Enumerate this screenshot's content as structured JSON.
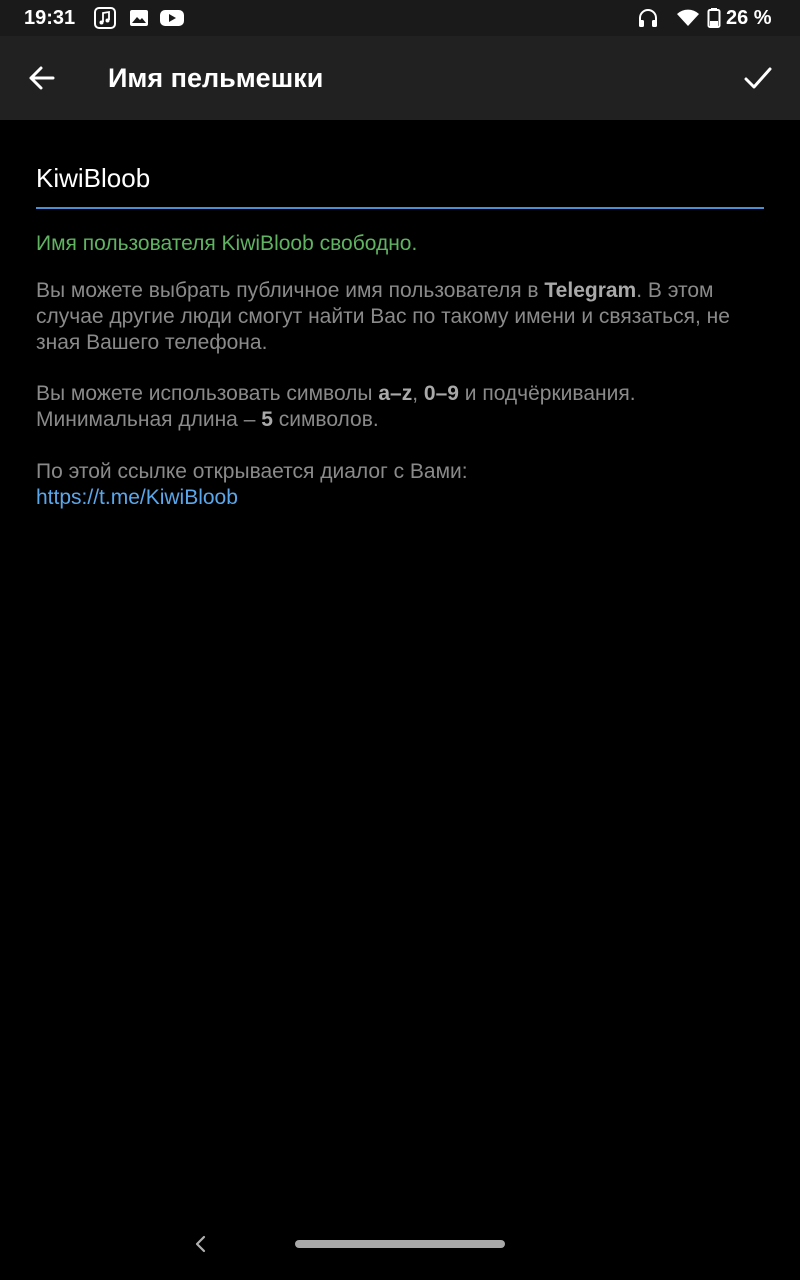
{
  "status_bar": {
    "time": "19:31",
    "battery_percent": "26 %",
    "left_icons": [
      "music-note-icon",
      "image-icon",
      "youtube-icon"
    ],
    "right_icons": [
      "headphones-icon",
      "wifi-icon",
      "battery-icon"
    ]
  },
  "toolbar": {
    "title": "Имя пельмешки",
    "back_icon": "arrow-left-icon",
    "done_icon": "checkmark-icon"
  },
  "form": {
    "username_value": "KiwiBloob",
    "availability_text": "Имя пользователя KiwiBloob свободно.",
    "accent_color": "#4a8fd4",
    "success_color": "#5fb361"
  },
  "info": {
    "p1_part1": "Вы можете выбрать публичное имя пользователя в ",
    "p1_bold": "Telegram",
    "p1_part2": ". В этом случае другие люди смогут найти Вас по такому имени и связаться, не зная Вашего телефона.",
    "p2_part1": "Вы можете использовать символы ",
    "p2_bold1": "a–z",
    "p2_sep": ", ",
    "p2_bold2": "0–9",
    "p2_part2": " и подчёркивания. Минимальная длина – ",
    "p2_bold3": "5",
    "p2_part3": " символов.",
    "p3_text": "По этой ссылке открывается диалог с Вами:",
    "link_text": "https://t.me/KiwiBloob",
    "link_color": "#5aa7eb"
  },
  "nav_bar": {
    "back_icon": "chevron-left-icon",
    "handle": "home-gesture-handle"
  }
}
